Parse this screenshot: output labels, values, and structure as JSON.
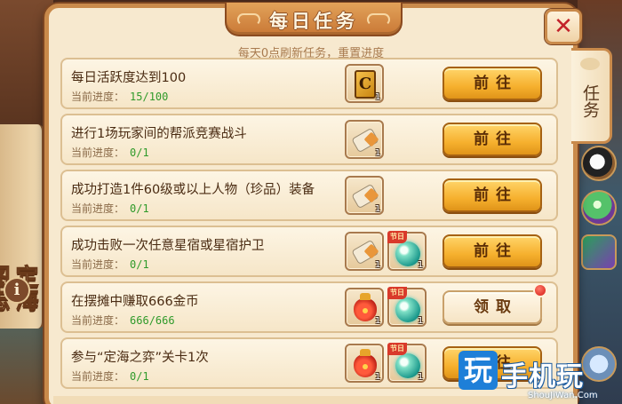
{
  "background": {
    "left_title": "定海图志",
    "info_icon": "i"
  },
  "dialog": {
    "title": "每日任务",
    "subtitle": "每天0点刷新任务，重置进度",
    "close_icon": "✕",
    "side_tab_label": "任务"
  },
  "progress_label": "当前进度：",
  "tasks": [
    {
      "name": "每日活跃度达到100",
      "progress": "15/100",
      "rewards": [
        {
          "icon": "gold-card-icon",
          "count": "1",
          "festival": false
        }
      ],
      "action": "前往",
      "action_type": "go",
      "has_red_dot": false
    },
    {
      "name": "进行1场玩家间的帮派竞赛战斗",
      "progress": "0/1",
      "rewards": [
        {
          "icon": "scroll-icon",
          "count": "1",
          "festival": false
        }
      ],
      "action": "前往",
      "action_type": "go",
      "has_red_dot": false
    },
    {
      "name": "成功打造1件60级或以上人物（珍品）装备",
      "progress": "0/1",
      "rewards": [
        {
          "icon": "scroll-icon",
          "count": "1",
          "festival": false
        }
      ],
      "action": "前往",
      "action_type": "go",
      "has_red_dot": false
    },
    {
      "name": "成功击败一次任意星宿或星宿护卫",
      "progress": "0/1",
      "rewards": [
        {
          "icon": "scroll-icon",
          "count": "1",
          "festival": false
        },
        {
          "icon": "pearl-icon",
          "count": "1",
          "festival": true
        }
      ],
      "action": "前往",
      "action_type": "go",
      "has_red_dot": false
    },
    {
      "name": "在摆摊中赚取666金币",
      "progress": "666/666",
      "rewards": [
        {
          "icon": "lucky-bag-icon",
          "count": "1",
          "festival": false
        },
        {
          "icon": "pearl-icon",
          "count": "1",
          "festival": true
        }
      ],
      "action": "领取",
      "action_type": "claim",
      "has_red_dot": true
    },
    {
      "name": "参与“定海之弈”关卡1次",
      "progress": "0/1",
      "rewards": [
        {
          "icon": "lucky-bag-icon",
          "count": "1",
          "festival": false
        },
        {
          "icon": "pearl-icon",
          "count": "1",
          "festival": true
        }
      ],
      "action": "前往",
      "action_type": "go",
      "has_red_dot": false
    }
  ],
  "festival_tag": "节日",
  "watermark": {
    "logo_char": "玩",
    "text": "手机玩",
    "url": "ShouJiWan.Com"
  },
  "colors": {
    "frame": "#c98a4b",
    "panel": "#f7e9cf",
    "button": "#f6b02e",
    "progress_value": "#2f9a2a",
    "close_x": "#c3222a"
  }
}
